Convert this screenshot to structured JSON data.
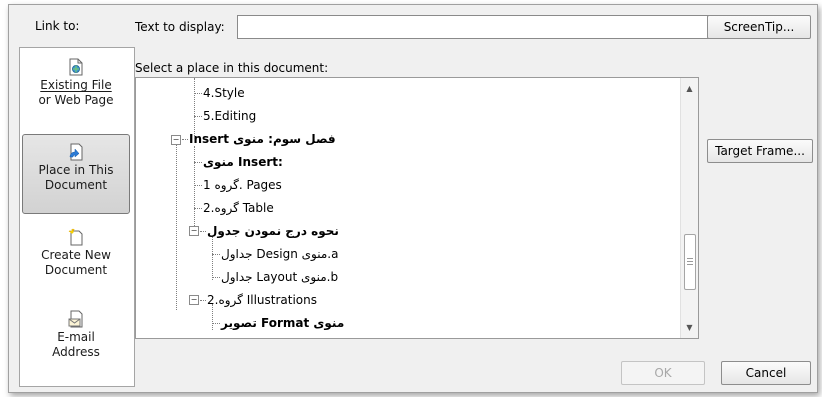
{
  "link_to": {
    "label": "Link to:",
    "items": [
      {
        "label_line1": "Existing File",
        "label_line2": "or Web Page",
        "icon": "existing-file-icon"
      },
      {
        "label_line1": "Place in This",
        "label_line2": "Document",
        "icon": "place-in-document-icon"
      },
      {
        "label_line1": "Create New",
        "label_line2": "Document",
        "icon": "create-new-document-icon"
      },
      {
        "label_line1": "E-mail",
        "label_line2": "Address",
        "icon": "email-address-icon"
      }
    ]
  },
  "text_to_display": {
    "label": "Text to display:",
    "value": ""
  },
  "buttons": {
    "screentip": "ScreenTip...",
    "target_frame": "Target Frame...",
    "ok": "OK",
    "cancel": "Cancel"
  },
  "select_place": {
    "label": "Select a place in this document:",
    "items": [
      {
        "text": "4.Style"
      },
      {
        "text": "5.Editing"
      },
      {
        "text": "Insert فصل سوم: منوی"
      },
      {
        "text": "منوی Insert:"
      },
      {
        "text": "گروه 1. Pages"
      },
      {
        "text": "گروه.2 Table"
      },
      {
        "text": "نحوه درج نمودن جدول"
      },
      {
        "text": "جداول Design منوی.a"
      },
      {
        "text": "جداول Layout منوی.b"
      },
      {
        "text": "گروه.2 Illustrations"
      },
      {
        "text": "تصویر Format منوی"
      }
    ]
  },
  "colors": {
    "dialog_bg": "#f0f0f0",
    "selected_bg": "#d8d8d8"
  }
}
